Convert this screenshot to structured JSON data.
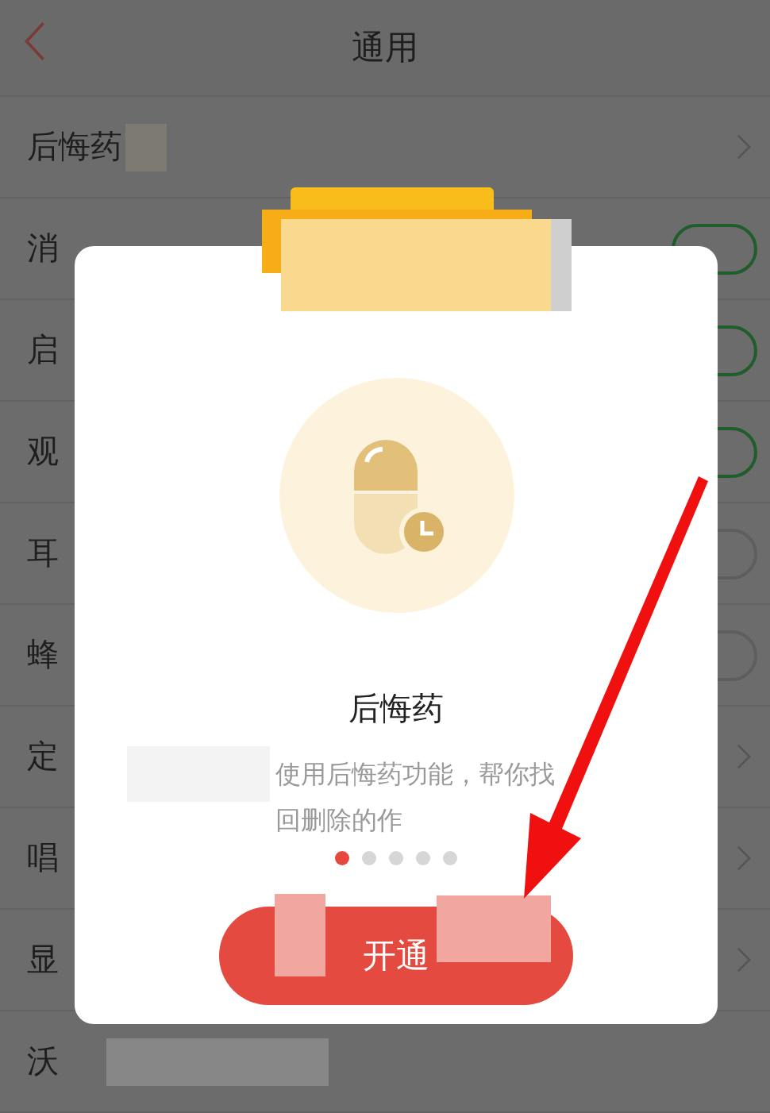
{
  "header": {
    "title": "通用"
  },
  "rows": [
    {
      "label": "后悔药",
      "kind": "link",
      "redacted": true
    },
    {
      "label": "消",
      "kind": "toggle",
      "on": true
    },
    {
      "label": "启",
      "kind": "toggle",
      "on": true
    },
    {
      "label": "观",
      "kind": "toggle",
      "on": true
    },
    {
      "label": "耳",
      "kind": "toggle",
      "on": false
    },
    {
      "label": "蜂",
      "kind": "toggle",
      "on": false
    },
    {
      "label": "定",
      "kind": "link",
      "redacted": false
    },
    {
      "label": "唱",
      "kind": "link",
      "redacted": false
    },
    {
      "label": "显",
      "kind": "link",
      "redacted": false
    },
    {
      "label": "沃",
      "kind": "plain",
      "redacted": true
    }
  ],
  "dialog": {
    "title": "后悔药",
    "description": [
      "使用后悔药功能，帮你找",
      "回删除的作"
    ],
    "pages": [
      {
        "selected": true
      },
      {
        "selected": false
      },
      {
        "selected": false
      },
      {
        "selected": false
      },
      {
        "selected": false
      }
    ],
    "button": "开通"
  }
}
